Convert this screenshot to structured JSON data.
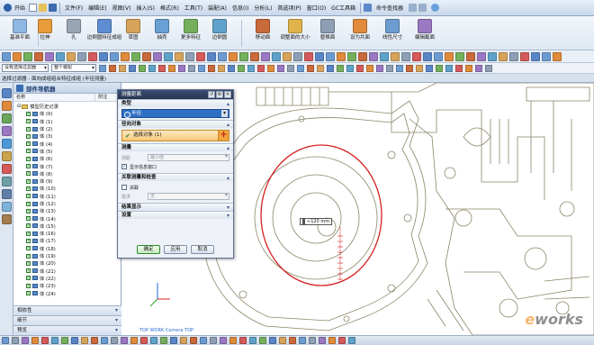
{
  "menubar": {
    "start_label": "开始",
    "items": [
      "文件(F)",
      "编辑(E)",
      "视图(V)",
      "插入(S)",
      "格式(R)",
      "工具(T)",
      "装配(A)",
      "信息(I)",
      "分析(L)",
      "首选项(P)",
      "窗口(O)",
      "GC工具箱"
    ],
    "command_finder": "命令查找器"
  },
  "ribbon": {
    "buttons": [
      {
        "label": "基准平面",
        "color": "#8fb7e3"
      },
      {
        "label": "拉伸",
        "color": "#e79b3a"
      },
      {
        "label": "孔",
        "color": "#9aa5b3"
      },
      {
        "label": "边倒圆特征成组",
        "color": "#5e8ed1"
      },
      {
        "label": "草图",
        "color": "#d7a35a"
      },
      {
        "label": "抽壳",
        "color": "#6ba0d5"
      },
      {
        "label": "更多特征",
        "color": "#74b05c"
      },
      {
        "label": "边倒圆",
        "color": "#5fa2c9"
      },
      {
        "label": "移动面",
        "color": "#c96a3b"
      },
      {
        "label": "调整面的大小",
        "color": "#e0b44a"
      },
      {
        "label": "替换面",
        "color": "#8e9fb3"
      },
      {
        "label": "设为共面",
        "color": "#e08a3c"
      },
      {
        "label": "线性尺寸",
        "color": "#6c9bd0"
      },
      {
        "label": "编辑截面",
        "color": "#9b78c2"
      }
    ]
  },
  "filters": {
    "select_filter": "没有选择过滤器",
    "assembly_filter": "整个装配"
  },
  "tab": {
    "label": "选择过滤器 - 面向成组组合特征成组 (半径测量)"
  },
  "navigator": {
    "title": "部件导航器",
    "col_name": "名称",
    "col_attached": "附注",
    "tree_root": "模型历史记录",
    "features": [
      "体 (0)",
      "体 (1)",
      "体 (2)",
      "体 (3)",
      "体 (4)",
      "体 (5)",
      "体 (6)",
      "体 (7)",
      "体 (8)",
      "体 (9)",
      "体 (10)",
      "体 (11)",
      "体 (12)",
      "体 (13)",
      "体 (14)",
      "体 (15)",
      "体 (16)",
      "体 (17)",
      "体 (18)",
      "体 (19)",
      "体 (20)",
      "体 (21)",
      "体 (22)",
      "体 (23)",
      "体 (24)"
    ],
    "sections": [
      "相依性",
      "细节",
      "预览"
    ]
  },
  "dialog": {
    "title": "测量距离",
    "sec_type": "类型",
    "type_value": "半径",
    "sec_radial": "径向对象",
    "select_object": "选择对象 (1)",
    "sec_measure": "测量",
    "label_method": "测距",
    "method_value": "最小值",
    "show_info_window": "显示信息窗口",
    "sec_assoc": "关联测量和检查",
    "assoc_label": "关联",
    "req_label": "需求",
    "req_value": "无",
    "sec_results": "结果显示",
    "sec_settings": "设置",
    "ok": "确定",
    "apply": "应用",
    "cancel": "取消"
  },
  "graphics": {
    "view_label": "TOP WORK Camera TOP",
    "measure_value": "≈120 mm",
    "watermark_prefix": "e",
    "watermark_rest": "works"
  }
}
